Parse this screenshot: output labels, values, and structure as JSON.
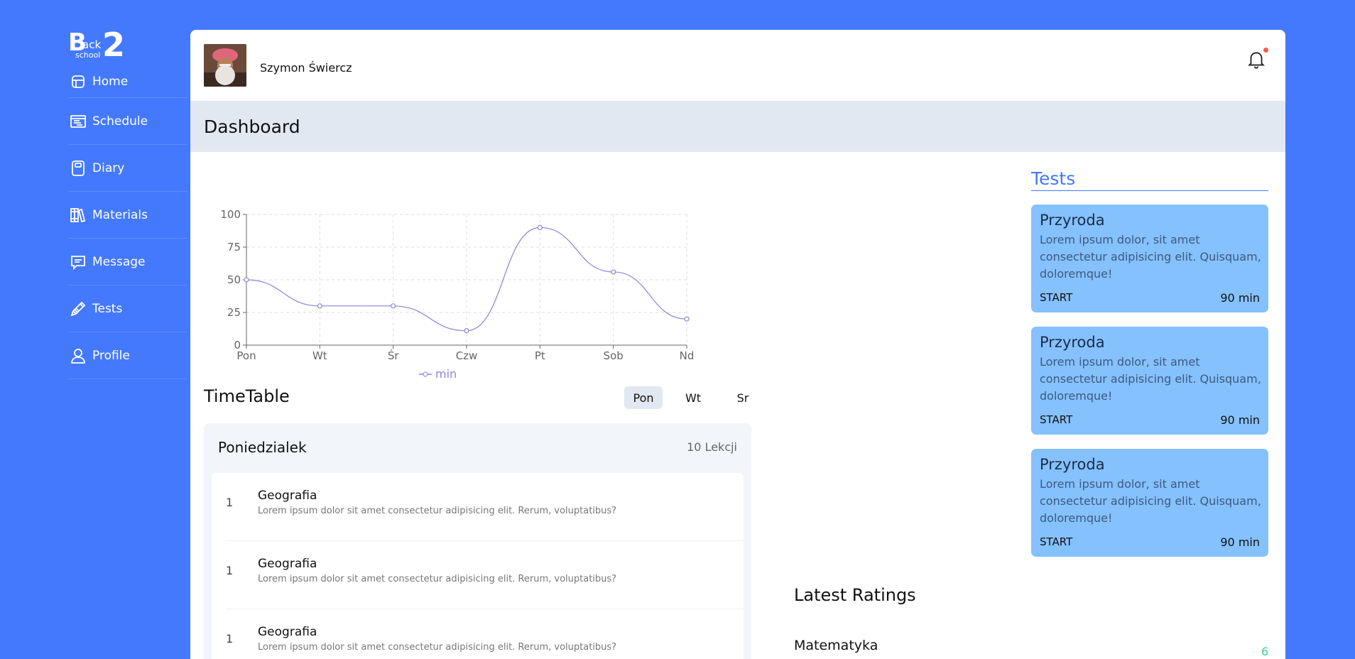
{
  "logo": {
    "b": "B",
    "ack": "ack",
    "school": "school",
    "two": "2"
  },
  "sidebar": {
    "items": [
      {
        "label": "Home",
        "icon": "home-icon"
      },
      {
        "label": "Schedule",
        "icon": "schedule-icon"
      },
      {
        "label": "Diary",
        "icon": "diary-icon"
      },
      {
        "label": "Materials",
        "icon": "materials-icon"
      },
      {
        "label": "Message",
        "icon": "message-icon"
      },
      {
        "label": "Tests",
        "icon": "pencil-icon"
      },
      {
        "label": "Profile",
        "icon": "user-icon"
      }
    ]
  },
  "header": {
    "user_name": "Szymon Świercz",
    "notification_icon": "bell-icon",
    "notification_dot_color": "#ff5a4f"
  },
  "page": {
    "title": "Dashboard"
  },
  "chart_data": {
    "type": "line",
    "categories": [
      "Pon",
      "Wt",
      "Śr",
      "Czw",
      "Pt",
      "Sob",
      "Nd"
    ],
    "series": [
      {
        "name": "min",
        "values": [
          50,
          30,
          30,
          11,
          90,
          56,
          20
        ]
      }
    ],
    "y_ticks": [
      "0",
      "25",
      "50",
      "75",
      "100"
    ],
    "ylim": [
      0,
      100
    ],
    "grid": true,
    "legend": "bottom",
    "color": "#8884d8"
  },
  "timetable": {
    "title": "TimeTable",
    "tabs": [
      "Pon",
      "Wt",
      "Sr"
    ],
    "active_tab": "Pon",
    "day_name": "Poniedzialek",
    "lesson_count": "10 Lekcji",
    "lessons": [
      {
        "num": "1",
        "subject": "Geografia",
        "desc": "Lorem ipsum dolor sit amet consectetur adipisicing elit. Rerum, voluptatibus?"
      },
      {
        "num": "1",
        "subject": "Geografia",
        "desc": "Lorem ipsum dolor sit amet consectetur adipisicing elit. Rerum, voluptatibus?"
      },
      {
        "num": "1",
        "subject": "Geografia",
        "desc": "Lorem ipsum dolor sit amet consectetur adipisicing elit. Rerum, voluptatibus?"
      }
    ]
  },
  "tests": {
    "title": "Tests",
    "cards": [
      {
        "title": "Przyroda",
        "desc": "Lorem ipsum dolor, sit amet consectetur adipisicing elit. Quisquam, doloremque!",
        "start": "START",
        "duration": "90 min"
      },
      {
        "title": "Przyroda",
        "desc": "Lorem ipsum dolor, sit amet consectetur adipisicing elit. Quisquam, doloremque!",
        "start": "START",
        "duration": "90 min"
      },
      {
        "title": "Przyroda",
        "desc": "Lorem ipsum dolor, sit amet consectetur adipisicing elit. Quisquam, doloremque!",
        "start": "START",
        "duration": "90 min"
      }
    ]
  },
  "ratings": {
    "title": "Latest Ratings",
    "items": [
      {
        "subject": "Matematyka",
        "value": "6"
      }
    ]
  },
  "colors": {
    "brand": "#4479fe",
    "test_card": "#85c1fc",
    "header_band": "#e2e8f1",
    "rating_good": "#3ecf8e"
  }
}
